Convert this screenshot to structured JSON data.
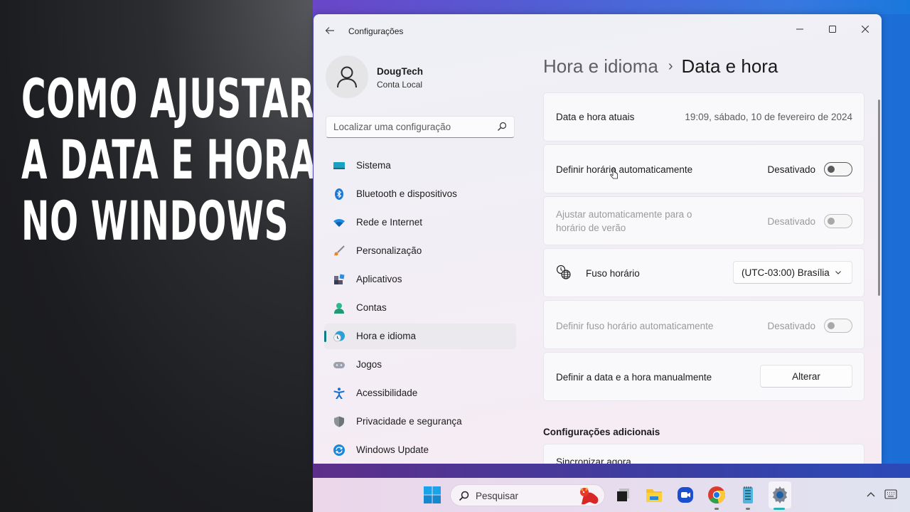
{
  "overlay": {
    "lines": [
      "COMO AJUSTAR",
      "A DATA E HORA",
      "NO WINDOWS"
    ]
  },
  "window": {
    "app_title": "Configurações",
    "controls": {
      "minimize": "–",
      "maximize": "☐",
      "close": "✕"
    }
  },
  "profile": {
    "name": "DougTech",
    "account_type": "Conta Local"
  },
  "search": {
    "placeholder": "Localizar uma configuração",
    "value": ""
  },
  "sidebar": {
    "items": [
      {
        "label": "Sistema",
        "icon": "system-icon"
      },
      {
        "label": "Bluetooth e dispositivos",
        "icon": "bluetooth-icon"
      },
      {
        "label": "Rede e Internet",
        "icon": "wifi-icon"
      },
      {
        "label": "Personalização",
        "icon": "brush-icon"
      },
      {
        "label": "Aplicativos",
        "icon": "apps-icon"
      },
      {
        "label": "Contas",
        "icon": "accounts-icon"
      },
      {
        "label": "Hora e idioma",
        "icon": "time-language-icon",
        "active": true
      },
      {
        "label": "Jogos",
        "icon": "gamepad-icon"
      },
      {
        "label": "Acessibilidade",
        "icon": "accessibility-icon"
      },
      {
        "label": "Privacidade e segurança",
        "icon": "shield-icon"
      },
      {
        "label": "Windows Update",
        "icon": "update-icon"
      }
    ]
  },
  "breadcrumb": {
    "parent": "Hora e idioma",
    "separator": "›",
    "current": "Data e hora"
  },
  "settings": {
    "current_datetime": {
      "label": "Data e hora atuais",
      "value": "19:09, sábado, 10 de fevereiro de 2024"
    },
    "auto_time": {
      "label": "Definir horário automaticamente",
      "state": "Desativado",
      "on": false,
      "enabled": true
    },
    "dst": {
      "label_line1": "Ajustar automaticamente para o",
      "label_line2": "horário de verão",
      "state": "Desativado",
      "on": false,
      "enabled": false
    },
    "timezone": {
      "label": "Fuso horário",
      "selected": "(UTC-03:00) Brasília"
    },
    "auto_timezone": {
      "label": "Definir fuso horário automaticamente",
      "state": "Desativado",
      "on": false,
      "enabled": false
    },
    "manual": {
      "label": "Definir a data e a hora manualmente",
      "button": "Alterar"
    }
  },
  "additional": {
    "title": "Configurações adicionais",
    "sync_label": "Sincronizar agora"
  },
  "taskbar": {
    "search_placeholder": "Pesquisar",
    "apps": [
      "start",
      "search",
      "task-view",
      "file-explorer",
      "meet",
      "chrome",
      "notepad",
      "settings"
    ],
    "active_app": "settings",
    "tray": [
      "show-hidden-icons",
      "keyboard"
    ]
  },
  "colors": {
    "accent": "#0f7b83",
    "taskbar_active": "#26b3b0"
  }
}
